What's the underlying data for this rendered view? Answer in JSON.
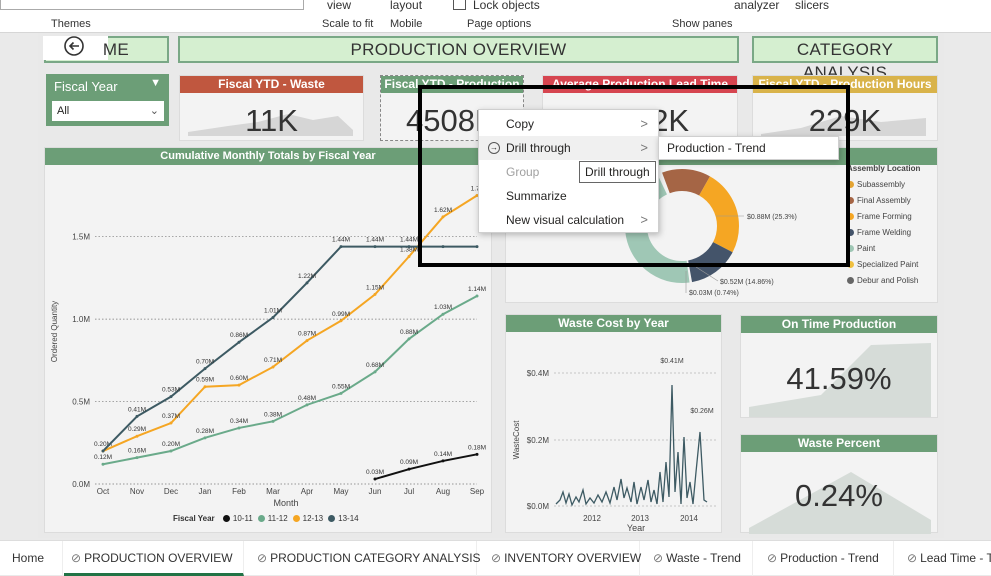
{
  "ribbon": {
    "themes": "Themes",
    "view": "view",
    "scale_to_fit": "Scale to fit",
    "layout": "layout",
    "mobile": "Mobile",
    "lock_objects": "Lock objects",
    "page_options": "Page options",
    "analyzer": "analyzer",
    "slicers": "slicers",
    "show_panes": "Show panes"
  },
  "headers": {
    "home": "ME",
    "production": "PRODUCTION OVERVIEW",
    "category": "CATEGORY ANALYSIS"
  },
  "slicer": {
    "title": "Fiscal Year",
    "value": "All"
  },
  "kpis": [
    {
      "title": "Fiscal YTD - Waste",
      "value": "11K",
      "color": "#c0573f"
    },
    {
      "title": "Fiscal YTD - Production",
      "value": "4508K",
      "color": "#6c9e77"
    },
    {
      "title": "Average Production Lead Time",
      "value": "27.82K",
      "color": "#d64550"
    },
    {
      "title": "Fiscal YTD - Production Hours",
      "value": "229K",
      "color": "#d9b34a"
    }
  ],
  "line_chart": {
    "title": "Cumulative Monthly Totals by Fiscal Year",
    "xlabel": "Month",
    "ylabel": "Ordered Quantity",
    "legend_title": "Fiscal Year",
    "series_names": [
      "10-11",
      "11-12",
      "12-13",
      "13-14"
    ]
  },
  "donut": {
    "legend_title": "Assembly Location",
    "legend": [
      {
        "name": "Subassembly",
        "color": "#e4a433"
      },
      {
        "name": "Final Assembly",
        "color": "#a56545"
      },
      {
        "name": "Frame Forming",
        "color": "#f5a623"
      },
      {
        "name": "Frame Welding",
        "color": "#44546a"
      },
      {
        "name": "Paint",
        "color": "#9fc7b5"
      },
      {
        "name": "Specialized Paint",
        "color": "#f0c040"
      },
      {
        "name": "Debur and Polish",
        "color": "#666666"
      }
    ],
    "labels": {
      "a": "$0.88M (25.3%)",
      "b": "$0.52M (14.86%)",
      "c": "$0.03M (0.74%)"
    }
  },
  "waste_cost": {
    "title": "Waste Cost by Year",
    "ylabel": "WasteCost",
    "xlabel": "Year",
    "yticks": [
      "$0.4M",
      "$0.2M",
      "$0.0M"
    ],
    "xticks": [
      "2012",
      "2013",
      "2014"
    ],
    "annotations": [
      "$0.41M",
      "$0.26M"
    ]
  },
  "on_time": {
    "title": "On Time Production",
    "value": "41.59%"
  },
  "waste_pct": {
    "title": "Waste Percent",
    "value": "0.24%"
  },
  "context_menu": {
    "items": [
      {
        "label": "Copy",
        "submenu": true,
        "enabled": true
      },
      {
        "label": "Drill through",
        "submenu": true,
        "enabled": true
      },
      {
        "label": "Group",
        "submenu": false,
        "enabled": false
      },
      {
        "label": "Summarize",
        "submenu": false,
        "enabled": true
      },
      {
        "label": "New visual calculation",
        "submenu": true,
        "enabled": true
      }
    ],
    "submenu_item": "Production - Trend",
    "tooltip": "Drill through"
  },
  "tabs": [
    "Home",
    "PRODUCTION OVERVIEW",
    "PRODUCTION CATEGORY ANALYSIS",
    "INVENTORY OVERVIEW",
    "Waste - Trend",
    "Production - Trend",
    "Lead Time - T"
  ],
  "chart_data": {
    "type": "line",
    "title": "Cumulative Monthly Totals by Fiscal Year",
    "xlabel": "Month",
    "ylabel": "Ordered Quantity",
    "categories": [
      "Oct",
      "Nov",
      "Dec",
      "Jan",
      "Feb",
      "Mar",
      "Apr",
      "May",
      "Jun",
      "Jul",
      "Aug",
      "Sep"
    ],
    "yticks": [
      "0.0M",
      "0.5M",
      "1.0M",
      "1.5M"
    ],
    "ylim": [
      0,
      1.85
    ],
    "legend": "bottom",
    "series": [
      {
        "name": "10-11",
        "color": "#111111",
        "values": [
          null,
          null,
          null,
          null,
          null,
          null,
          null,
          null,
          0.03,
          0.09,
          0.14,
          0.18
        ],
        "labels": [
          "",
          "",
          "",
          "",
          "",
          "",
          "",
          "",
          "0.03M",
          "0.09M",
          "0.14M",
          "0.18M"
        ]
      },
      {
        "name": "11-12",
        "color": "#6aaa8a",
        "values": [
          0.12,
          0.16,
          0.2,
          0.28,
          0.34,
          0.38,
          0.48,
          0.55,
          0.68,
          0.88,
          1.03,
          1.14
        ],
        "labels": [
          "0.12M",
          "0.16M",
          "0.20M",
          "0.28M",
          "0.34M",
          "0.38M",
          "0.48M",
          "0.55M",
          "0.68M",
          "0.88M",
          "1.03M",
          "1.14M"
        ]
      },
      {
        "name": "12-13",
        "color": "#f5a623",
        "values": [
          0.2,
          0.29,
          0.37,
          0.59,
          0.6,
          0.71,
          0.87,
          0.99,
          1.15,
          1.38,
          1.62,
          1.75
        ],
        "labels": [
          "0.20M",
          "0.29M",
          "0.37M",
          "0.59M",
          "0.60M",
          "0.71M",
          "0.87M",
          "0.99M",
          "1.15M",
          "1.38M",
          "1.62M",
          "1.75"
        ]
      },
      {
        "name": "13-14",
        "color": "#3d5a63",
        "values": [
          0.2,
          0.41,
          0.53,
          0.7,
          0.86,
          1.01,
          1.22,
          1.44,
          1.44,
          1.44,
          1.44,
          1.44
        ],
        "labels": [
          "",
          "0.41M",
          "0.53M",
          "0.70M",
          "0.86M",
          "1.01M",
          "1.22M",
          "1.44M",
          "1.44M",
          "1.44M",
          "",
          ""
        ]
      }
    ]
  }
}
